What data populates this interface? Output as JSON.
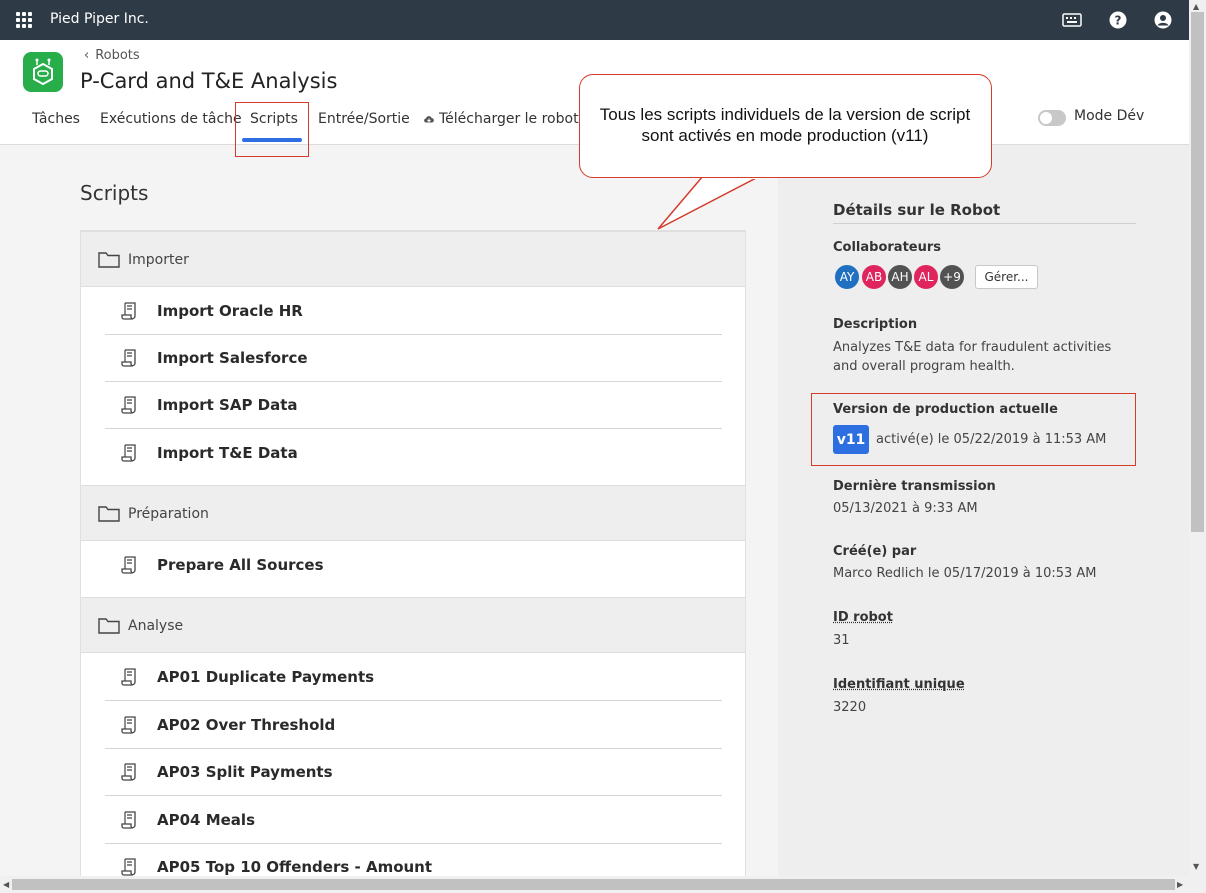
{
  "topbar": {
    "org_name": "Pied Piper Inc.",
    "icons": [
      "apps-grid-icon",
      "keyboard-icon",
      "help-icon",
      "user-icon"
    ]
  },
  "header": {
    "breadcrumb": "Robots",
    "title": "P-Card and T&E Analysis",
    "tabs": [
      "Tâches",
      "Exécutions de tâche",
      "Scripts",
      "Entrée/Sortie",
      "Télécharger le robot"
    ],
    "active_tab": "Scripts",
    "mode_label": "Mode Dév"
  },
  "callout": {
    "text": "Tous les scripts individuels de la version de script sont activés en mode production (v11)"
  },
  "main": {
    "title": "Scripts",
    "folders": [
      {
        "name": "Importer",
        "scripts": [
          "Import Oracle HR",
          "Import Salesforce",
          "Import SAP Data",
          "Import T&E Data"
        ]
      },
      {
        "name": "Préparation",
        "scripts": [
          "Prepare All Sources"
        ]
      },
      {
        "name": "Analyse",
        "scripts": [
          "AP01 Duplicate Payments",
          "AP02 Over Threshold",
          "AP03 Split Payments",
          "AP04 Meals",
          "AP05 Top 10 Offenders - Amount"
        ]
      }
    ]
  },
  "details": {
    "title": "Détails sur le Robot",
    "collaborators_label": "Collaborateurs",
    "avatars": [
      {
        "initials": "AY",
        "color": "#1f70c1"
      },
      {
        "initials": "AB",
        "color": "#e0245e"
      },
      {
        "initials": "AH",
        "color": "#525252"
      },
      {
        "initials": "AL",
        "color": "#e0245e"
      },
      {
        "initials": "+9",
        "color": "#525252"
      }
    ],
    "manage_label": "Gérer...",
    "description_label": "Description",
    "description": "Analyzes T&E data for fraudulent activities and overall program health.",
    "prod_version_label": "Version de production actuelle",
    "prod_version": "v11",
    "prod_version_activated": "activé(e) le 05/22/2019 à 11:53 AM",
    "last_commit_label": "Dernière transmission",
    "last_commit": "05/13/2021 à 9:33 AM",
    "created_by_label": "Créé(e) par",
    "created_by": "Marco Redlich le 05/17/2019 à 10:53 AM",
    "robot_id_label": "ID robot",
    "robot_id": "31",
    "unique_id_label": "Identifiant unique",
    "unique_id": "3220"
  }
}
